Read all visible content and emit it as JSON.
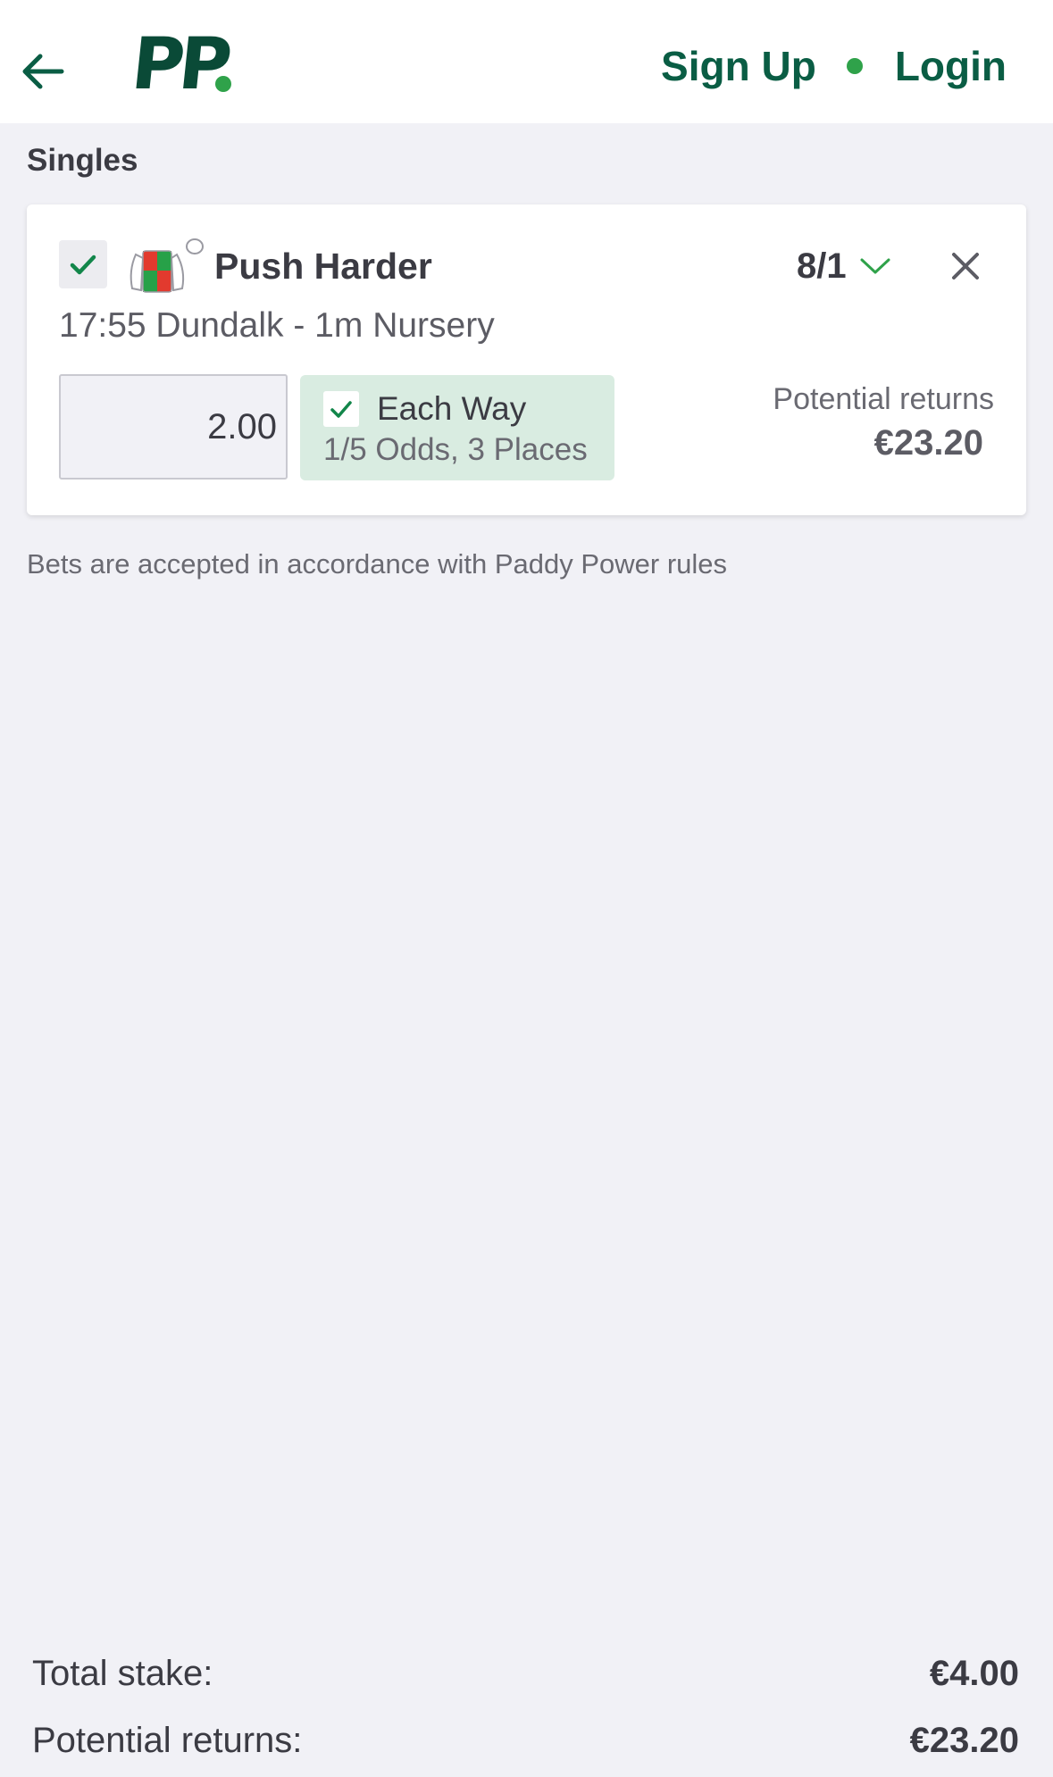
{
  "header": {
    "logo_text": "PP",
    "sign_up_label": "Sign Up",
    "login_label": "Login",
    "brand_color": "#0a5d44",
    "accent_color": "#2fa24a"
  },
  "betslip": {
    "section_title": "Singles",
    "bets": [
      {
        "selected": true,
        "selection_name": "Push Harder",
        "odds": "8/1",
        "event": "17:55 Dundalk - 1m Nursery",
        "stake": "2.00",
        "each_way": {
          "checked": true,
          "label": "Each Way",
          "terms": "1/5 Odds, 3 Places"
        },
        "potential_returns_label": "Potential returns",
        "potential_returns_value": "€23.20"
      }
    ],
    "rules_note": "Bets are accepted in accordance with Paddy Power rules"
  },
  "footer": {
    "total_stake_label": "Total stake:",
    "total_stake_value": "€4.00",
    "potential_returns_label": "Potential returns:",
    "potential_returns_value": "€23.20"
  }
}
